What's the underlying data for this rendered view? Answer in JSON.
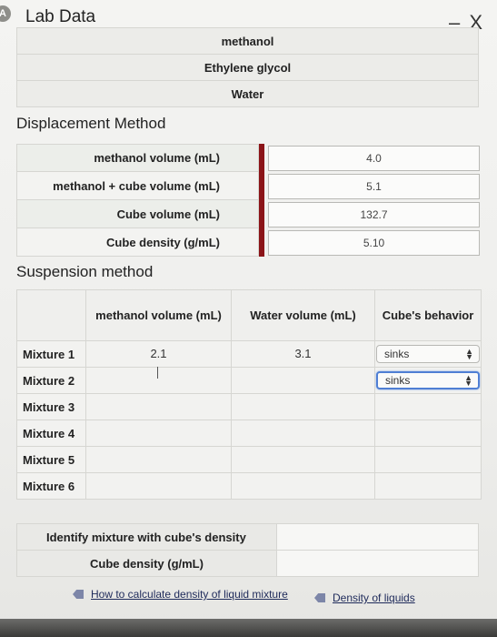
{
  "window": {
    "title": "Lab Data",
    "minimize": "–",
    "close": "X",
    "icon": "app-icon"
  },
  "top_list": [
    "methanol",
    "Ethylene glycol",
    "Water"
  ],
  "displacement": {
    "title": "Displacement Method",
    "rows": [
      {
        "label": "methanol volume (mL)",
        "value": "4.0"
      },
      {
        "label": "methanol + cube volume (mL)",
        "value": "5.1"
      },
      {
        "label": "Cube volume (mL)",
        "value": "132.7"
      },
      {
        "label": "Cube density (g/mL)",
        "value": "5.10"
      }
    ],
    "accent_color": "#8b1418"
  },
  "suspension": {
    "title": "Suspension method",
    "headers": {
      "methanol": "methanol volume (mL)",
      "water": "Water volume (mL)",
      "behavior": "Cube's behavior"
    },
    "rows": [
      {
        "label": "Mixture 1",
        "methanol": "2.1",
        "water": "3.1",
        "behavior": "sinks"
      },
      {
        "label": "Mixture 2",
        "methanol": "",
        "water": "",
        "behavior": "sinks"
      },
      {
        "label": "Mixture 3",
        "methanol": "",
        "water": "",
        "behavior": ""
      },
      {
        "label": "Mixture 4",
        "methanol": "",
        "water": "",
        "behavior": ""
      },
      {
        "label": "Mixture 5",
        "methanol": "",
        "water": "",
        "behavior": ""
      },
      {
        "label": "Mixture 6",
        "methanol": "",
        "water": "",
        "behavior": ""
      }
    ]
  },
  "identify": {
    "label": "Identify mixture with cube's density",
    "density_label": "Cube density (g/mL)"
  },
  "links": {
    "calc": "How to calculate density of liquid mixture",
    "liquids": "Density of liquids"
  }
}
